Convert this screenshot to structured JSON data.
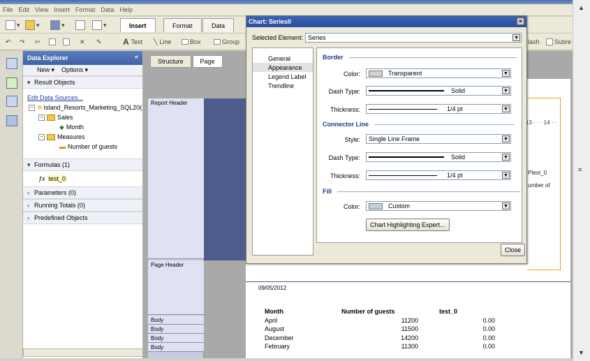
{
  "menu": [
    "File",
    "Edit",
    "View",
    "Insert",
    "Format",
    "Data",
    "Help"
  ],
  "ribbon": {
    "tabs": [
      "Insert",
      "Format",
      "Data"
    ],
    "active_tab": "Insert",
    "insert_tools": [
      "Text",
      "Line",
      "Box",
      "Group"
    ],
    "right_tools": [
      "lash",
      "Subre"
    ]
  },
  "explorer": {
    "title": "Data Explorer",
    "tools": [
      "New ▾",
      "Options ▾"
    ],
    "result_objects": "Result Objects",
    "edit_sources": "Edit Data Sources...",
    "universe": "Island_Resorts_Marketing_SQL20(",
    "sales_folder": "Sales",
    "month": "Month",
    "measures_folder": "Measures",
    "guests": "Number of guests",
    "formulas": "Formulas (1)",
    "formula_item": "test_0",
    "parameters": "Parameters (0)",
    "running_totals": "Running Totals (0)",
    "predefined": "Predefined Objects"
  },
  "canvas": {
    "tabs": [
      "Structure",
      "Page"
    ],
    "active_tab": "Page",
    "sections": {
      "report_header": "Report Header",
      "page_header": "Page Header",
      "body": [
        "Body",
        "Body",
        "Body",
        "Body"
      ]
    },
    "ruler": "· 13 · · · 14 · ·",
    "side_text_1": "Ptest_0",
    "side_text_2": "umber of",
    "date": "09/05/2012",
    "table": {
      "headers": [
        "Month",
        "Number of guests",
        "test_0"
      ],
      "rows": [
        [
          "April",
          "11200",
          "0.00"
        ],
        [
          "August",
          "11500",
          "0.00"
        ],
        [
          "December",
          "14200",
          "0.00"
        ],
        [
          "February",
          "11300",
          "0.00"
        ]
      ]
    }
  },
  "dialog": {
    "title": "Chart: Series0",
    "close_x": "×",
    "selected_element_label": "Selected Element:",
    "selected_element_value": "Series",
    "nav": [
      "General",
      "Appearance",
      "Legend Label",
      "Trendline"
    ],
    "nav_selected": 1,
    "border": {
      "title": "Border",
      "color_label": "Color:",
      "color_value": "Transparent",
      "dash_label": "Dash Type:",
      "dash_value": "Solid",
      "thickness_label": "Thickness:",
      "thickness_value": "1/4 pt"
    },
    "connector": {
      "title": "Connector Line",
      "style_label": "Style:",
      "style_value": "Single Line Frame",
      "dash_label": "Dash Type:",
      "dash_value": "Solid",
      "thickness_label": "Thickness:",
      "thickness_value": "1/4 pt"
    },
    "fill": {
      "title": "Fill",
      "color_label": "Color:",
      "color_value": "Custom"
    },
    "highlight_button": "Chart Highlighting Expert...",
    "close_button": "Close"
  }
}
